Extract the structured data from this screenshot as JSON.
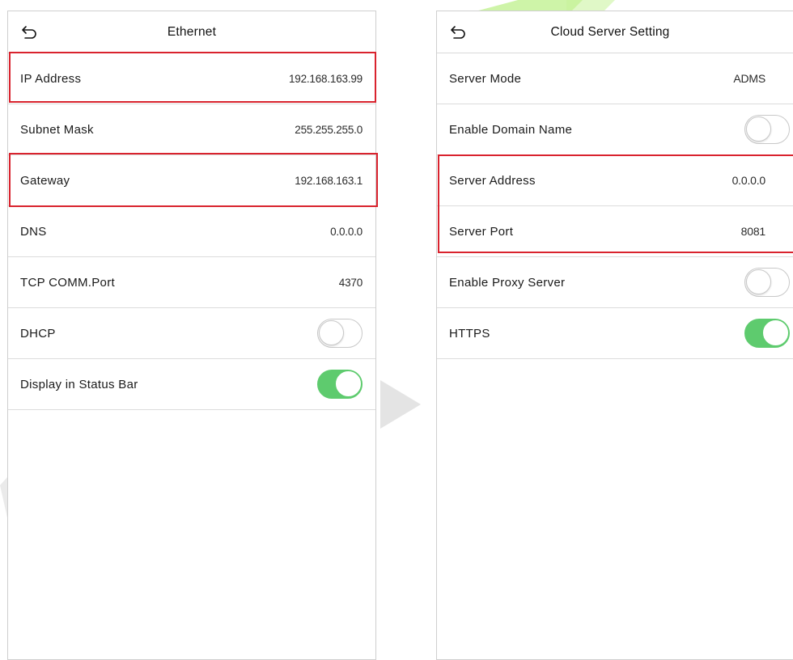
{
  "colors": {
    "accent_red": "#d9232e",
    "toggle_on": "#5ecb6e",
    "watermark": "#c6f299"
  },
  "left_screen": {
    "title": "Ethernet",
    "back_icon": "back-arrow-icon",
    "rows": [
      {
        "label": "IP Address",
        "value": "192.168.163.99"
      },
      {
        "label": "Subnet Mask",
        "value": "255.255.255.0"
      },
      {
        "label": "Gateway",
        "value": "192.168.163.1"
      },
      {
        "label": "DNS",
        "value": "0.0.0.0"
      },
      {
        "label": "TCP COMM.Port",
        "value": "4370"
      },
      {
        "label": "DHCP",
        "toggle": false
      },
      {
        "label": "Display in Status Bar",
        "toggle": true
      }
    ]
  },
  "right_screen": {
    "title": "Cloud Server Setting",
    "back_icon": "back-arrow-icon",
    "rows": [
      {
        "label": "Server Mode",
        "value": "ADMS"
      },
      {
        "label": "Enable Domain Name",
        "toggle": false
      },
      {
        "label": "Server Address",
        "value": "0.0.0.0"
      },
      {
        "label": "Server Port",
        "value": "8081"
      },
      {
        "label": "Enable Proxy Server",
        "toggle": false
      },
      {
        "label": "HTTPS",
        "toggle": true
      }
    ]
  }
}
